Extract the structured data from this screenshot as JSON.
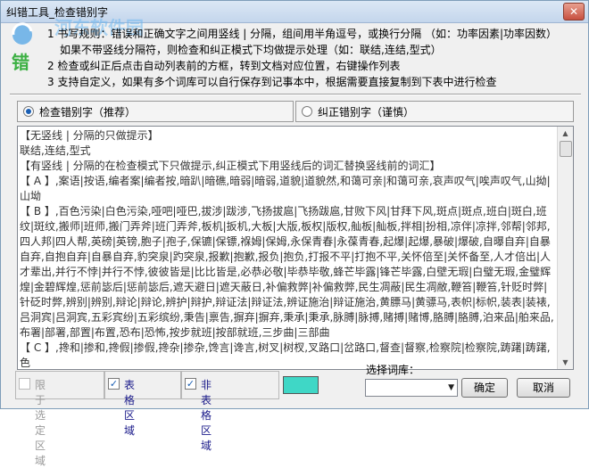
{
  "window": {
    "title": "纠错工具_检查错别字",
    "close_glyph": "✕"
  },
  "watermark": "河东软件园",
  "rules": [
    "1 书写规则：错误和正确文字之间用竖线 | 分隔，组间用半角逗号，或换行分隔 （如：功率因素|功率因数）",
    "如果不带竖线分隔符，则检查和纠正模式下均做提示处理（如：联结,连结,型式）",
    "2 检查或纠正后点击自动列表前的方框，转到文档对应位置，右键操作列表",
    "3 支持自定义，如果有多个词库可以自行保存到记事本中，根据需要直接复制到下表中进行检查"
  ],
  "modes": {
    "check": {
      "label": "检查错别字（推荐）",
      "selected": true
    },
    "correct": {
      "label": "纠正错别字（谨慎）",
      "selected": false
    }
  },
  "dictionary_text": [
    "【无竖线 | 分隔的只做提示】",
    "联结,连结,型式",
    "【有竖线 | 分隔的在检查模式下只做提示,纠正模式下用竖线后的词汇替换竖线前的词汇】",
    "【 A 】,案语|按语,编者案|编者按,暗趴|暗礁,暗弱|暗弱,道貌|道貌然,和蔼可亲|和蔼可亲,哀声叹气|唉声叹气,山拗|山坳",
    "【 B 】,百色污染|白色污染,哑吧|哑巴,拔涉|跋涉,飞扬拔扈|飞扬跋扈,甘败下风|甘拜下风,斑点|斑点,班白|斑白,班纹|斑纹,搬师|班师,搬门弄斧|班门弄斧,板机|扳机,大板|大版,板权|版权,舢板|舢板,拌相|扮相,凉伴|凉拌,邻帮|邻邦,四人邦|四人帮,英磅|英镑,胞子|孢子,保镳|保镖,褓姆|保姆,永保青春|永葆青春,起爆|起爆,暴破|爆破,自曝自弃|自暴自弃,自抱自弃|自暴自弃,豹突泉|趵突泉,报歉|抱歉,报负|抱负,打报不平|打抱不平,关怀倍至|关怀备至,人才倍出|人才辈出,并行不悖|并行不悖,彼彼皆是|比比皆是,必恭必敬|毕恭毕敬,蜂芒毕露|锋芒毕露,白壁无瑕|白璧无瑕,金璧辉煌|金碧辉煌,惩前毖后|惩前毖后,遮天避日|遮天蔽日,补偏救弊|补偏救弊,民生凋蔽|民生凋敝,鞭笞|鞭笞,针贬时弊|针砭时弊,辨别|辨别,辩论|辩论,辨护|辩护,辩证法|辩证法,辨证施治|辩证施治,黄膘马|黄骠马,表帜|标帜,装表|装裱,吕洞宾|吕洞宾,五彩宾纷|五彩缤纷,秉告|禀告,摒弃|摒弃,秉承|秉承,脉膊|脉搏,赌搏|赌博,胳膊|胳膊,泊来品|舶来品,布署|部署,部置|布置,恐布|恐怖,按步就班|按部就班,三步曲|三部曲",
    "【 C 】,搀和|掺和,搀假|掺假,搀杂|掺杂,馋言|谗言,树叉|树杈,叉路口|岔路口,督查|督察,检察院|检察院,踌躇|踌躇,色"
  ],
  "bottom": {
    "only_selected": {
      "label": "限于选定区域",
      "checked": false,
      "disabled": true
    },
    "table_area": {
      "label": "表格区域",
      "checked": true
    },
    "non_table_area": {
      "label": "非表格区域",
      "checked": true
    },
    "highlight_color": "#3fd7c6",
    "library_label": "选择词库：",
    "library_value": "",
    "ok_label": "确定",
    "cancel_label": "取消"
  }
}
